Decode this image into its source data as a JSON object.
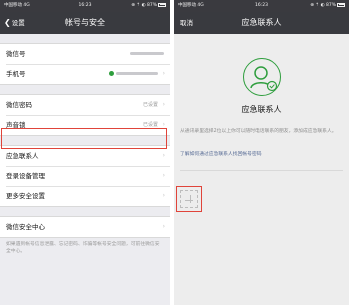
{
  "left": {
    "status": {
      "carrier": "中国移动 4G",
      "time": "16:23",
      "right": "⊕ ⇡ ◐ 87%"
    },
    "nav": {
      "back": "设置",
      "title": "帐号与安全"
    },
    "group1": [
      {
        "label": "微信号",
        "value_hidden": true
      },
      {
        "label": "手机号",
        "value_hidden": true,
        "has_lock": true
      }
    ],
    "group2": [
      {
        "label": "微信密码",
        "value": "已设置"
      },
      {
        "label": "声音锁",
        "value": "已设置"
      }
    ],
    "group3": [
      {
        "label": "应急联系人"
      },
      {
        "label": "登录设备管理"
      },
      {
        "label": "更多安全设置"
      }
    ],
    "group4": [
      {
        "label": "微信安全中心"
      }
    ],
    "footnote": "如果遇到帐号信息泄露、忘记密码、诈骗等帐号安全问题，可前往微信安全中心。"
  },
  "right": {
    "status": {
      "carrier": "中国移动 4G",
      "time": "16:23",
      "right": "⊕ ⇡ ◐ 87%"
    },
    "nav": {
      "cancel": "取消",
      "title": "应急联系人"
    },
    "title": "应急联系人",
    "description": "从通讯录里选择2位以上你可以随时电话联系的朋友，添加成应急联系人。",
    "link": "了解如何通过应急联系人找回帐号密码",
    "add_icon": "plus-icon"
  },
  "colors": {
    "navbar": "#393a3f",
    "accent_green": "#2f9e3e",
    "highlight_red": "#e0443a",
    "link": "#576b95"
  }
}
